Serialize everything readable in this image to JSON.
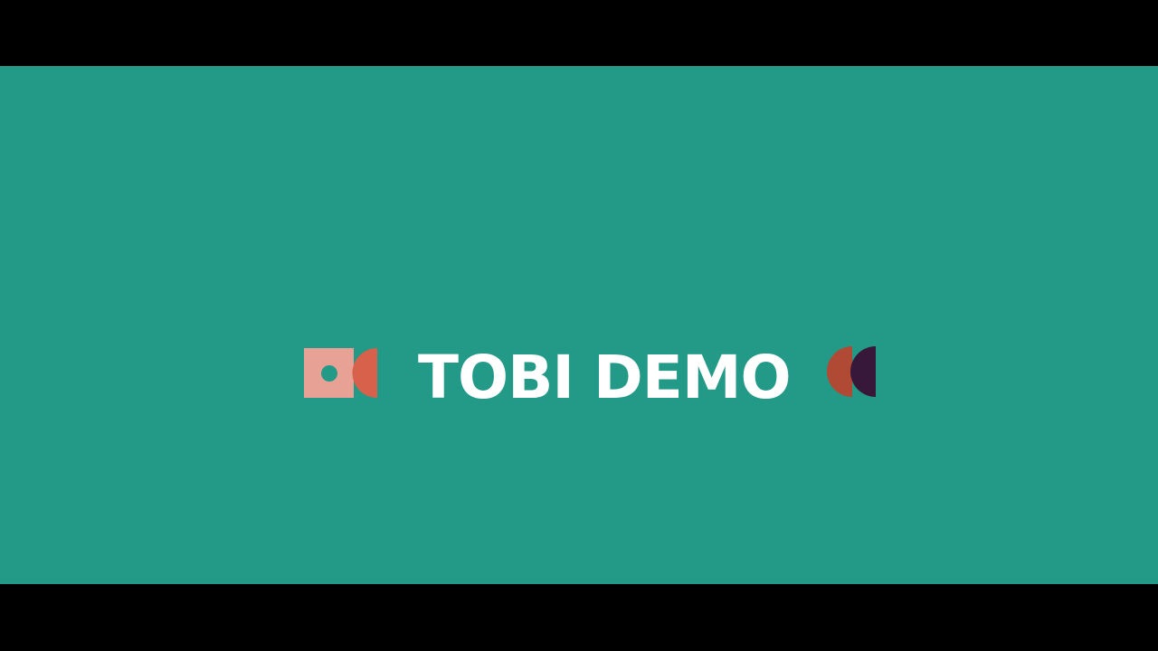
{
  "title": "TOBI DEMO",
  "colors": {
    "background": "#239a87",
    "letterbox": "#000000",
    "title_text": "#ffffff",
    "square": "#e8a195",
    "dot": "#239a87",
    "half_circle_left": "#d7614a",
    "half_circle_right_a": "#b04a34",
    "half_circle_right_b": "#37183a"
  },
  "decorations": {
    "left": [
      "square-with-dot-icon",
      "half-circle-icon"
    ],
    "right": [
      "half-circle-icon",
      "half-circle-icon"
    ]
  }
}
